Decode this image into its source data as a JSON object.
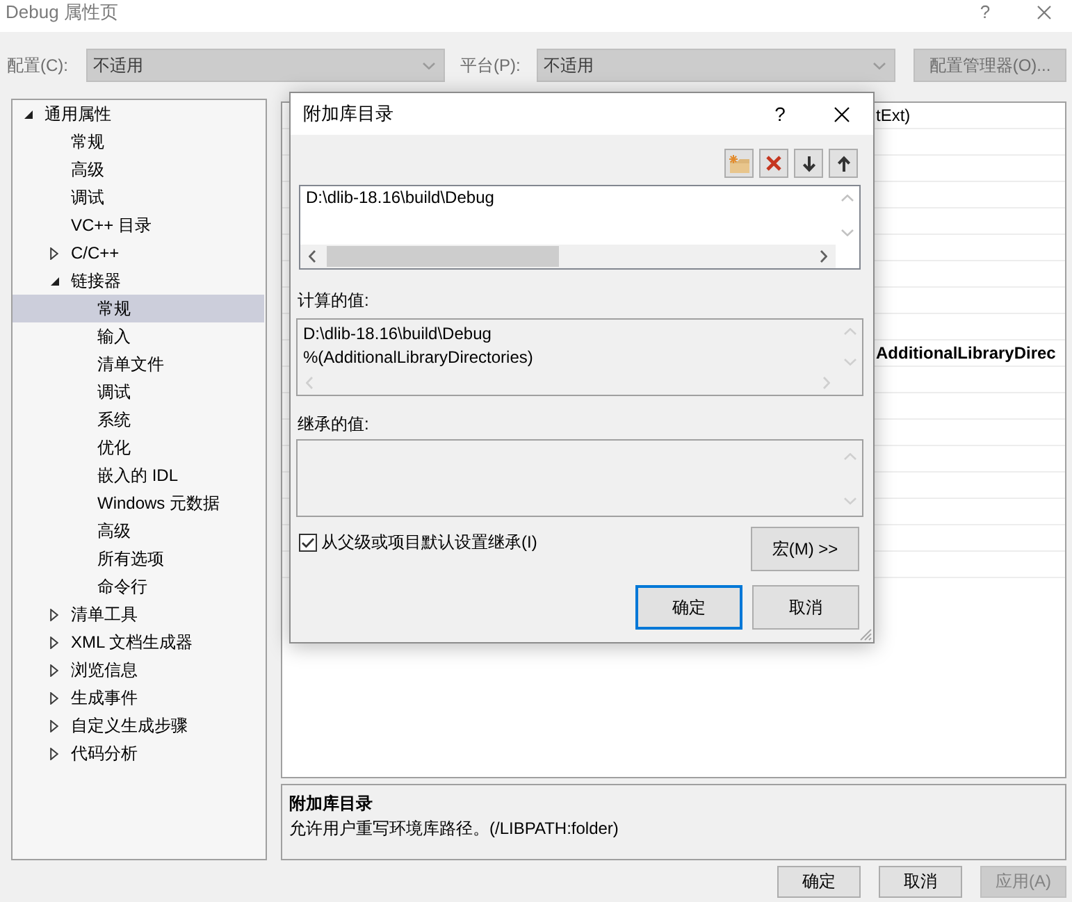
{
  "window": {
    "title": "Debug 属性页",
    "help": "?"
  },
  "toolbar": {
    "configuration": {
      "label": "配置(C):",
      "value": "不适用",
      "disabled": true
    },
    "platform": {
      "label": "平台(P):",
      "value": "不适用",
      "disabled": true
    },
    "manager_button": {
      "label": "配置管理器(O)...",
      "disabled": true
    }
  },
  "tree": {
    "items": [
      {
        "label": "通用属性",
        "kind": "group",
        "expanded": true,
        "selected": false,
        "children": [
          {
            "label": "常规",
            "kind": "page",
            "selected": false
          },
          {
            "label": "高级",
            "kind": "page",
            "selected": false
          },
          {
            "label": "调试",
            "kind": "page",
            "selected": false
          },
          {
            "label": "VC++ 目录",
            "kind": "page",
            "selected": false
          },
          {
            "label": "C/C++",
            "kind": "group",
            "expanded": false,
            "selected": false
          },
          {
            "label": "链接器",
            "kind": "group",
            "expanded": true,
            "selected": false,
            "children": [
              {
                "label": "常规",
                "kind": "page",
                "selected": true
              },
              {
                "label": "输入",
                "kind": "page",
                "selected": false
              },
              {
                "label": "清单文件",
                "kind": "page",
                "selected": false
              },
              {
                "label": "调试",
                "kind": "page",
                "selected": false
              },
              {
                "label": "系统",
                "kind": "page",
                "selected": false
              },
              {
                "label": "优化",
                "kind": "page",
                "selected": false
              },
              {
                "label": "嵌入的 IDL",
                "kind": "page",
                "selected": false
              },
              {
                "label": "Windows 元数据",
                "kind": "page",
                "selected": false
              },
              {
                "label": "高级",
                "kind": "page",
                "selected": false
              },
              {
                "label": "所有选项",
                "kind": "page",
                "selected": false
              },
              {
                "label": "命令行",
                "kind": "page",
                "selected": false
              }
            ]
          },
          {
            "label": "清单工具",
            "kind": "group",
            "expanded": false,
            "selected": false
          },
          {
            "label": "XML 文档生成器",
            "kind": "group",
            "expanded": false,
            "selected": false
          },
          {
            "label": "浏览信息",
            "kind": "group",
            "expanded": false,
            "selected": false
          },
          {
            "label": "生成事件",
            "kind": "group",
            "expanded": false,
            "selected": false
          },
          {
            "label": "自定义生成步骤",
            "kind": "group",
            "expanded": false,
            "selected": false
          },
          {
            "label": "代码分析",
            "kind": "group",
            "expanded": false,
            "selected": false
          }
        ]
      }
    ]
  },
  "property_grid": {
    "rows": [
      {
        "value": "tExt)",
        "bold": false
      },
      {},
      {},
      {},
      {},
      {},
      {},
      {},
      {},
      {
        "value": "AdditionalLibraryDirec",
        "bold": true
      },
      {},
      {},
      {},
      {},
      {},
      {},
      {},
      {}
    ]
  },
  "description": {
    "title": "附加库目录",
    "text": "允许用户重写环境库路径。(/LIBPATH:folder)"
  },
  "buttons": [
    {
      "label": "确定",
      "disabled": false
    },
    {
      "label": "取消",
      "disabled": false
    },
    {
      "label": "应用(A)",
      "disabled": true
    }
  ],
  "dialog": {
    "title": "附加库目录",
    "help": "?",
    "entries": [
      {
        "text": "D:\\dlib-18.16\\build\\Debug",
        "selected": false
      }
    ],
    "computed_label": "计算的值:",
    "computed_values": [
      "D:\\dlib-18.16\\build\\Debug",
      "%(AdditionalLibraryDirectories)"
    ],
    "inherited_label": "继承的值:",
    "inherit": {
      "label": "从父级或项目默认设置继承(I)",
      "checked": true
    },
    "macro_button": "宏(M) >>",
    "buttons": [
      {
        "label": "确定",
        "default": true
      },
      {
        "label": "取消",
        "default": false
      }
    ]
  }
}
